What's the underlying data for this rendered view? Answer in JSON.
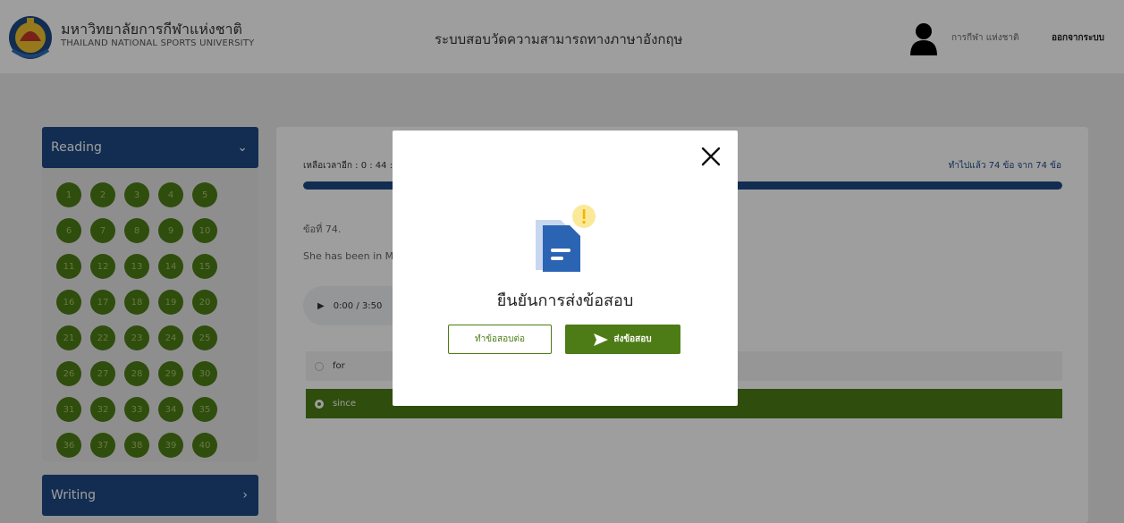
{
  "header": {
    "university_th": "มหาวิทยาลัยการกีฬาแห่งชาติ",
    "university_en": "THAILAND NATIONAL SPORTS UNIVERSITY",
    "system_title": "ระบบสอบวัดความสามารถทางภาษาอังกฤษ",
    "user_name": "การกีฬา แห่งชาติ",
    "logout_label": "ออกจากระบบ"
  },
  "sidebar": {
    "reading_label": "Reading",
    "writing_label": "Writing",
    "question_numbers": [
      "1",
      "2",
      "3",
      "4",
      "5",
      "6",
      "7",
      "8",
      "9",
      "10",
      "11",
      "12",
      "13",
      "14",
      "15",
      "16",
      "17",
      "18",
      "19",
      "20",
      "21",
      "22",
      "23",
      "24",
      "25",
      "26",
      "27",
      "28",
      "29",
      "30",
      "31",
      "32",
      "33",
      "34",
      "35",
      "36",
      "37",
      "38",
      "39",
      "40"
    ]
  },
  "main": {
    "time_left": "เหลือเวลาอีก : 0 : 44 :",
    "progress_text": "ทำไปแล้ว 74 ข้อ จาก 74 ข้อ",
    "progress_fraction": 1.0,
    "question_no": "ข้อที่ 74.",
    "question_text": "She has been in M",
    "audio_time": "0:00 / 3:50",
    "options": [
      {
        "label": "for",
        "selected": false
      },
      {
        "label": "since",
        "selected": true
      }
    ]
  },
  "modal": {
    "title": "ยืนยันการส่งข้อสอบ",
    "continue_label": "ทำข้อสอบต่อ",
    "submit_label": "ส่งข้อสอบ"
  },
  "icons": {
    "close": "close-icon",
    "document_alert": "document-alert-icon",
    "send": "send-icon",
    "user": "user-icon",
    "logo": "university-logo"
  },
  "colors": {
    "primary_blue": "#1e4a83",
    "green": "#4d7c16"
  }
}
